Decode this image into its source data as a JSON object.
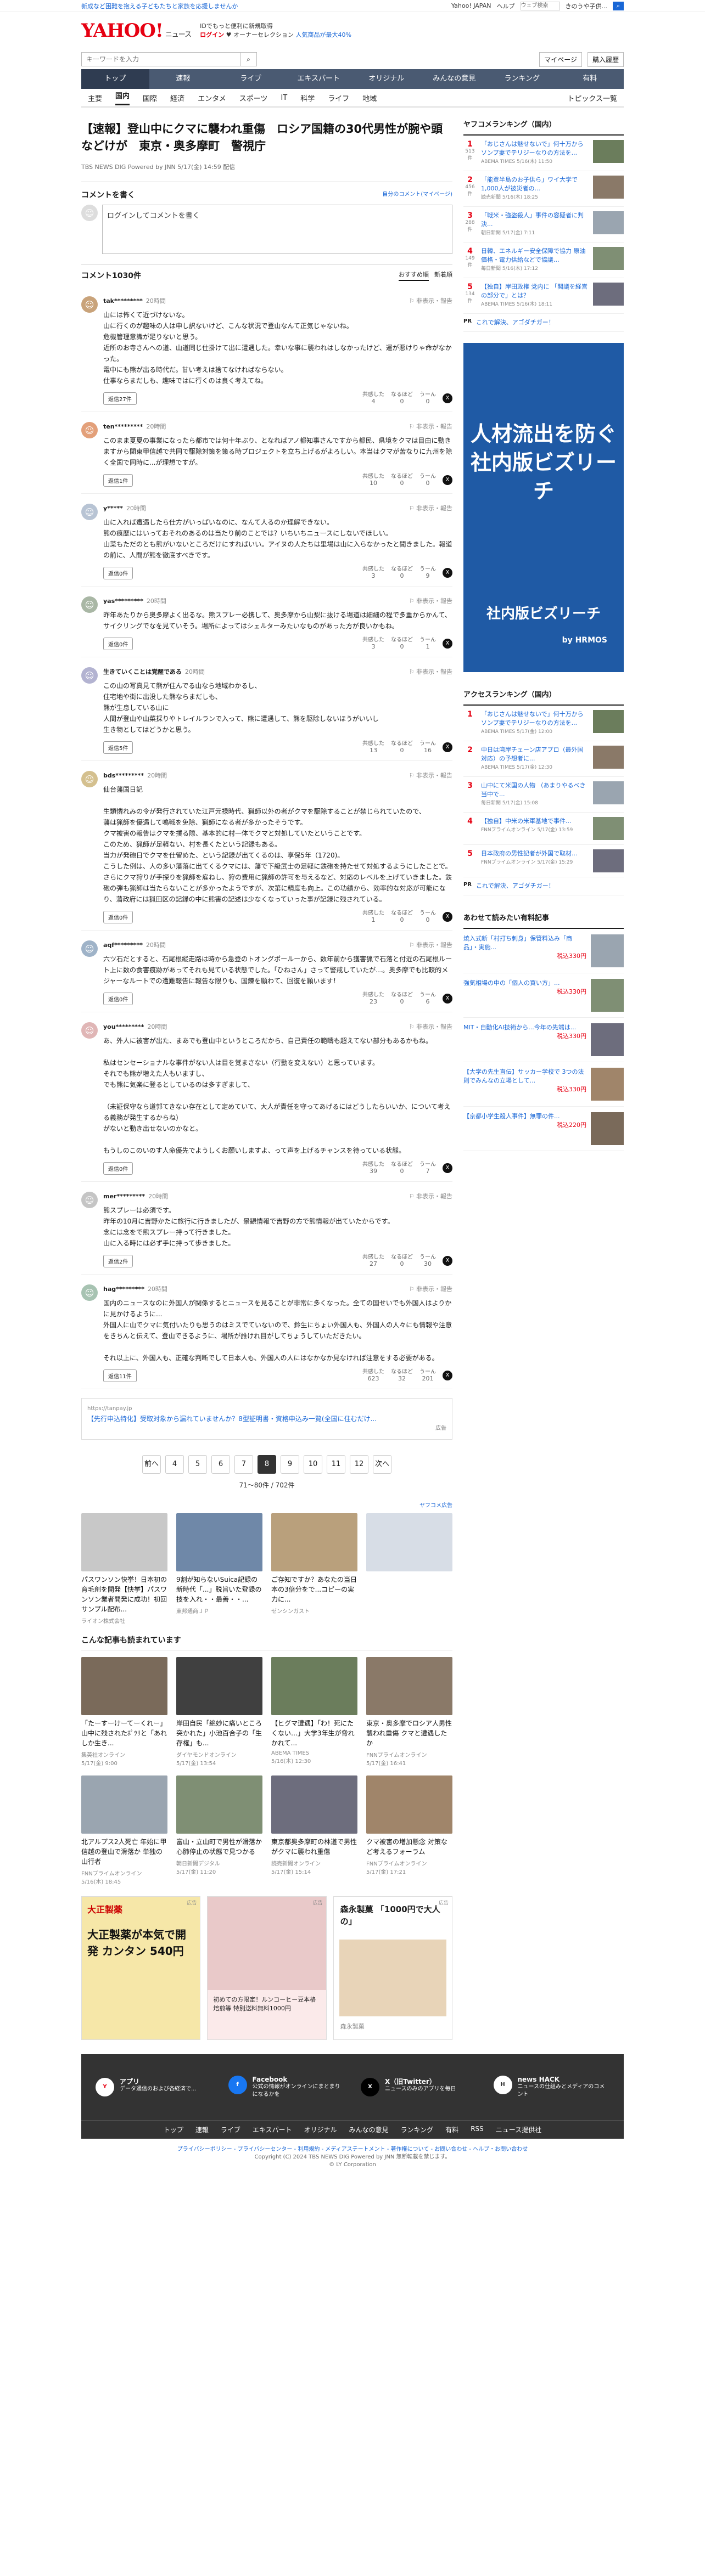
{
  "topbar": {
    "left": "新成など困難を抱える子どもたちと家族を応援しませんか",
    "links": [
      "Yahoo! JAPAN",
      "ヘルプ"
    ],
    "search_placeholder": "ウェブ検索",
    "search_hint": "きのうや子供..."
  },
  "header": {
    "logo": "YAHOO!",
    "logo_sub": "ニュース",
    "line1": "IDでもっと便利に新規取得",
    "line2": "ログイン",
    "line3": "オーナーセレクション",
    "line4": "人気商品が最大40%"
  },
  "search": {
    "placeholder": "キーワードを入力",
    "tools": [
      "マイページ",
      "購入履歴"
    ]
  },
  "gnav": [
    "トップ",
    "速報",
    "ライブ",
    "エキスパート",
    "オリジナル",
    "みんなの意見",
    "ランキング",
    "有料"
  ],
  "snav": [
    "主要",
    "国内",
    "国際",
    "経済",
    "エンタメ",
    "スポーツ",
    "IT",
    "科学",
    "ライフ",
    "地域"
  ],
  "snav_right": "トピックス一覧",
  "article": {
    "title": "【速報】登山中にクマに襲われ重傷　ロシア国籍の30代男性が腕や頭などけが　東京・奥多摩町　警視庁",
    "meta": "TBS NEWS DIG Powered by JNN 5/17(金) 14:59 配信"
  },
  "comment_box": {
    "title": "コメントを書く",
    "own": "自分のコメント(マイページ)",
    "placeholder": "ログインしてコメントを書く"
  },
  "comments_header": {
    "count": "コメント1030件",
    "sort": [
      "おすすめ順",
      "新着順"
    ]
  },
  "comments": [
    {
      "user": "tak*********",
      "time": "20時間",
      "text": "山には怖くて近づけないな。\n山に行くのが趣味の人は申し訳ないけど、こんな状況で登山なんて正気じゃないね。\n危機管理意識が足りないと思う。\n近所のお寺さんへの道、山道同じ仕掛けて出に遭遇した。幸いな事に襲われはしなかったけど、運が悪けりゃ命がなかった。\n電中にも熊が出る時代だ。甘い考えは捨てなければならない。\n仕事ならまだしも、趣味ではに行くのは良く考えてね。",
      "replies": "返信27件",
      "up": "4",
      "mid": "0",
      "down": "0"
    },
    {
      "user": "ten*********",
      "time": "20時間",
      "text": "このまま夏夏の事業になったら都市では何十年ぶり、となればアノ都知事さんですから都民、県境をクマは目由に動きますから関東甲信越で共同で駆除対策を策る時プロジェクトを立ち上げるがよろしい。本当はクマが苦なりに九州を除く全国で同時に...が理想ですが。",
      "replies": "返信1件",
      "up": "10",
      "mid": "0",
      "down": "0"
    },
    {
      "user": "y*****",
      "time": "20時間",
      "text": "山に入れば遭遇したら仕方がいっぱいなのに、なんて人るのか理解できない。\n熊の痕歴にはいっておそれのあるのは当たり前のことでは？いちいちニュースにしないでほしい。\n山菜もただのとも熊がいないところだけにすればいい。アイヌの人たちは里場は山に入らなかったと聞きました。報道の前に、人間が熊を徹底すべきです。",
      "replies": "返信0件",
      "up": "3",
      "mid": "0",
      "down": "9"
    },
    {
      "user": "yas*********",
      "time": "20時間",
      "text": "昨年あたりから奥多摩よく出るな。熊スプレー必携して、奥多摩から山梨に抜ける場道は細細の程で多重からかんて、サイクリングでなを見ていそう。場所によってはシェルターみたいなものがあった方が良いかもね。",
      "replies": "返信0件",
      "up": "3",
      "mid": "0",
      "down": "1"
    },
    {
      "user": "生きていくことは覚醒である",
      "time": "20時間",
      "text": "この山の写真見て熊が住んでる山なら地域わかるし、\n住宅地や街に出没した熊ならまだしも、\n熊が生息している山に\n人間が登山や山菜採りやトレイルランで入って、熊に遭遇して、熊を駆除しないほうがいいし\n生き物としてはどうかと思う。",
      "replies": "返信5件",
      "up": "13",
      "mid": "0",
      "down": "16"
    },
    {
      "user": "bds*********",
      "time": "20時間",
      "text": "仙台藩国日記\n\n生類憐れみの令が発行されていた江戸元禄時代、猟師以外の者がクマを駆除することが禁じられていたので、\n藩は猟師を優遇して鳴戦を免除、猟師になる者が多かったそうです。\nクマ被害の報告はクマを撲る際、基本的に村一体でクマと対処していたということです。\nこのため、猟師が足軽ない、村を長くたという記録もある。\n当力が発砲日でクマを仕留めた、という記録が出てくるのは、享保5年（1720)。\nこうした例は、人の多い藩落に出てくるクマには、藩で下級武士の足軽に鉄砲を持たせて対処するようにしたことで。さらにクマ狩りが手探りを猟師を雇ねし、狩の費用に猟師の許可を与えるなど、対応のレベルを上げていきました。鉄砲の弾も猟師は当たらないことが多かったようですが、次第に精度も向上。この功績から、効率的な対応が可能になり、藩政府には猟田区の記録の中に熊害の記述は少なくなっていった事が記録に残されている。",
      "replies": "返信0件",
      "up": "1",
      "mid": "0",
      "down": "0"
    },
    {
      "user": "aqf*********",
      "time": "20時間",
      "text": "六ツ石だとすると、石尾根縦走路は時から急登のトオングポールーから、数年前から獲害猟で石落と付近の石尾根ルート上に数の食害痕跡があってそれも見ている状態でした。「ひねさん」さって警戒していたが…。奥多摩でも比較的メジャーなルートでの遭難報告に報告な限りも、国錬を願わて、回復を願います！",
      "replies": "返信0件",
      "up": "23",
      "mid": "0",
      "down": "6"
    },
    {
      "user": "you*********",
      "time": "20時間",
      "text": "あ、外人に被害が出た、まあでも登山中というところだから、自己責任の範疇も超えてない部分もあるかもね。\n\n私はセンセーショナルな事件がない人は目を覚まさない（行動を変えない）と思っています。\nそれでも熊が増えた人もいますし、\nでも熊に気楽に登るとしているのは多すぎまして、\n\n（未証保守なら道郭てきない存在として定めていて、大人が責任を守ってあげるにはどうしたらいいか、について考える義務が発生するからね)\nがないと動き出せないのかなと。\n\nもうしのこのいのす人命優先でようしくお願いしますよ、って声を上げるチャンスを待っている状態。",
      "replies": "返信0件",
      "up": "39",
      "mid": "0",
      "down": "7"
    },
    {
      "user": "mer*********",
      "time": "20時間",
      "text": "熊スプレーは必須です。\n昨年の10月に吉野かたに旅行に行きましたが、景観情報で吉野の方で熊情報が出ていたからです。\n念には念をで熊スプレー持って行きました。\n山に入る時には必ず手に持って歩きました。",
      "replies": "返信2件",
      "up": "27",
      "mid": "0",
      "down": "30"
    },
    {
      "user": "hag*********",
      "time": "20時間",
      "text": "国内のニュースなのに外国人が関係するとニュースを見ることが非常に多くなった。全ての国せいでも外国人はよりかに見かけるように...\n外国人に山でクマに気付いたりも思うのはミスでていないので、鈴生にちょい外国人も、外国人の人々にも情報や注意をきちんと伝えて、登山できるように、場所が誰けれ目がしてちょうしていただきたい。\n\nそれ以上に、外国人も、正確な判断でして日本人も、外国人の人にはなかなか見なければ注意をする必要がある。",
      "replies": "返信11件",
      "up": "623",
      "mid": "32",
      "down": "201"
    }
  ],
  "ad_inline": {
    "src": "https://tanpay.jp",
    "text": "【先行申込特化】受取対象から漏れていませんか？8型証明書・資格申込み一覧(全国に住むだけ...",
    "label": "広告"
  },
  "pagination": {
    "pages": [
      "前へ",
      "4",
      "5",
      "6",
      "7",
      "8",
      "9",
      "10",
      "11",
      "12",
      "次へ"
    ],
    "current": "8",
    "info": "71〜80件 / 702件"
  },
  "sponsor_src": "ヤフコメ広告",
  "promos": [
    {
      "title": "パスワンソン快挙！日本初の育毛剤を開発【快挙】パスワンソン業者開発に成功！初回サンプル配布...",
      "src": "ライオン株式会社"
    },
    {
      "title": "9割が知らないSuica記録の新時代「...」脱旨いた登録の技を入れ・・最善・・...",
      "src": "東邦通商ＪＰ"
    },
    {
      "title": "ご存知ですか？あなたの当日本の3倍分をで...コピーの実力に...",
      "src": "ゼンシンガスト"
    },
    {
      "title": "",
      "src": ""
    }
  ],
  "more_title": "こんな記事も読まれています",
  "more": [
    {
      "title": "「たーすーけーてーくれー」山中に残されたﾎﾟﾂﾘと「あれしか生き...",
      "src": "集英社オンライン",
      "time": "5/17(金) 9:00"
    },
    {
      "title": "岸田自民「絶妙に痛いところ突かれた」小池百合子の「生存権」も...",
      "src": "ダイヤモンドオンライン",
      "time": "5/17(金) 13:54"
    },
    {
      "title": "【ヒグマ遭遇】「わ！死にたくない…」大学3年生が脅れかれて...",
      "src": "ABEMA TIMES",
      "time": "5/16(木) 12:30"
    },
    {
      "title": "東京・奥多摩でロシア人男性襲われ重傷 クマと遭遇したか",
      "src": "FNNプライムオンライン",
      "time": "5/17(金) 16:41"
    },
    {
      "title": "北アルプス2人死亡 年始に甲信越の登山で滑落か 単独の山行者",
      "src": "FNNプライムオンライン",
      "time": "5/16(木) 18:45"
    },
    {
      "title": "富山・立山町で男性が滑落か 心肺停止の状態で見つかる",
      "src": "朝日新聞デジタル",
      "time": "5/17(金) 11:20"
    },
    {
      "title": "東京都奥多摩町の林道で男性がクマに襲われ重傷",
      "src": "読売新聞オンライン",
      "time": "5/17(金) 15:14"
    },
    {
      "title": "クマ被害の増加懸念 対策など考えるフォーラム",
      "src": "FNNプライムオンライン",
      "time": "5/17(金) 17:21"
    }
  ],
  "bottom_ads": [
    {
      "title": "大正製薬",
      "caption": "大正製薬が本気で開発 カンタン 540円",
      "label": "広告"
    },
    {
      "title": "初めての方限定！ルンコーヒー豆本格焙煎等 特別送料無料1000円",
      "caption": "",
      "label": "広告"
    },
    {
      "title": "森永製菓 「1000円で大人の」",
      "caption": "森永製菓",
      "label": "広告"
    }
  ],
  "sidebar": {
    "access_title": "ヤフコメランキング（国内）",
    "access": [
      {
        "no": "1",
        "cnt": "513件",
        "title": "「おじさんは魅せないで」何十万からソンプ妻でテリジーなりの方法を...",
        "src": "ABEMA TIMES 5/16(木) 11:50"
      },
      {
        "no": "2",
        "cnt": "456件",
        "title": "「能登半島のお子供ら」ワイ大学で 1,000人が被災者の...",
        "src": "読売新聞 5/16(木) 18:25"
      },
      {
        "no": "3",
        "cnt": "288件",
        "title": "「戦米・強盗殺人」事件の容疑者に判決...",
        "src": "朝日新聞 5/17(金) 7:11"
      },
      {
        "no": "4",
        "cnt": "149件",
        "title": "日韓、エネルギー安全保障で協力 原油価格・電力供給などで協議…",
        "src": "毎日新聞 5/16(木) 17:12"
      },
      {
        "no": "5",
        "cnt": "134件",
        "title": "【独自】岸田政権 党内に 「閣議を経営の部分で」とは？",
        "src": "ABEMA TIMES 5/16(木) 18:11"
      }
    ],
    "pr_label": "PR",
    "pr_text": "これで解決、アゴダチガー！",
    "bigad": {
      "headline": "人材流出を防ぐ社内版ビズリーチ",
      "sub": "社内版ビズリーチ",
      "brand": "by HRMOS"
    },
    "access2_title": "アクセスランキング（国内）",
    "access2": [
      {
        "no": "1",
        "title": "「おじさんは魅せないで」何十万からソンプ妻でテリジーなりの方法を...",
        "src": "ABEMA TIMES 5/17(金) 12:00"
      },
      {
        "no": "2",
        "title": "中日は湾岸チェーン店アプロ（最外国対応）の予想者に...",
        "src": "ABEMA TIMES 5/17(金) 12:30"
      },
      {
        "no": "3",
        "title": "山中にて米国の人物 （あまりやるべき当中で...",
        "src": "毎日新聞 5/17(金) 15:08"
      },
      {
        "no": "4",
        "title": "【独自】中米の米軍基地で事件...",
        "src": "FNNプライムオンライン 5/17(金) 13:59"
      },
      {
        "no": "5",
        "title": "日本政府の男性記者が外国で取材...",
        "src": "FNNプライムオンライン 5/17(金) 15:29"
      }
    ],
    "products_title": "あわせて読みたい有料記事",
    "products": [
      {
        "title": "焼入式新「村打ち刺身」保管料込み「商品」・実施...",
        "price": "税込330円"
      },
      {
        "title": "強気相場の中の「個人の買い方」...",
        "price": "税込330円"
      },
      {
        "title": "MIT・自動化AI技術から...今年の先端は...",
        "price": "税込330円"
      },
      {
        "title": "【大学の先生直伝】サッカー学校で 3つの法則でみんなの立場として...",
        "price": "税込330円"
      },
      {
        "title": "【京都小学生殺人事件】無罪の件...",
        "price": "税込220円"
      }
    ]
  },
  "footer": {
    "apps": [
      {
        "name": "アプリ",
        "desc": "データ通信のおよび各経済で...",
        "icon": "Y"
      },
      {
        "name": "Facebook",
        "desc": "公式の情報がオンラインにまとまりになるかを",
        "icon": "f"
      },
      {
        "name": "X（旧Twitter）",
        "desc": "ニュースのみのアプリを毎日",
        "icon": "X"
      },
      {
        "name": "news HACK",
        "desc": "ニュースの仕組みとメディアのコメント",
        "icon": "H"
      }
    ],
    "nav": [
      "トップ",
      "速報",
      "ライブ",
      "エキスパート",
      "オリジナル",
      "みんなの意見",
      "ランキング",
      "有料",
      "RSS",
      "ニュース提供社"
    ],
    "links": "プライバシーポリシー - プライバシーセンター - 利用規約 - メディアステートメント - 著作権について - お問い合わせ - ヘルプ・お問い合わせ",
    "copy1": "Copyright (C) 2024 TBS NEWS DIG Powered by JNN 無断転載を禁じます。",
    "copy2": "© LY Corporation"
  }
}
